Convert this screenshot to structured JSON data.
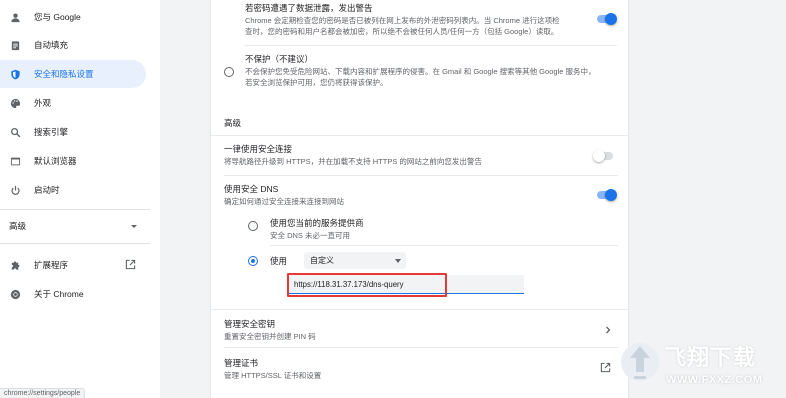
{
  "sidebar": {
    "items": [
      {
        "label": "您与 Google",
        "icon": "person-icon"
      },
      {
        "label": "自动填充",
        "icon": "clipboard-icon"
      },
      {
        "label": "安全和隐私设置",
        "icon": "shield-icon",
        "active": true
      },
      {
        "label": "外观",
        "icon": "palette-icon"
      },
      {
        "label": "搜索引擎",
        "icon": "search-icon"
      },
      {
        "label": "默认浏览器",
        "icon": "browser-icon"
      },
      {
        "label": "启动时",
        "icon": "power-icon"
      }
    ],
    "advanced_label": "高级",
    "extensions_label": "扩展程序",
    "about_label": "关于 Chrome"
  },
  "main": {
    "breach_warning": {
      "title": "若密码遭遇了数据泄露，发出警告",
      "line1": "Chrome 会定期检查您的密码是否已被列在网上发布的外泄密码列表内。当 Chrome 进行这项检",
      "line2": "查时，您的密码和用户名都会被加密，所以绝不会被任何人员/任何一方（包括 Google）读取。",
      "enabled": true
    },
    "no_protection": {
      "title": "不保护（不建议）",
      "line1": "不会保护您免受危险网站、下载内容和扩展程序的侵害。在 Gmail 和 Google 搜索等其他 Google 服务中，",
      "line2": "若安全浏览保护可用，您仍将获得该保护。"
    },
    "advanced_header": "高级",
    "https_only": {
      "title": "一律使用安全连接",
      "subtitle": "将导航路径升级到 HTTPS，并在加载不支持 HTTPS 的网站之前向您发出警告",
      "enabled": false
    },
    "secure_dns": {
      "title": "使用安全 DNS",
      "subtitle": "确定如何通过安全连接来连接到网站",
      "enabled": true,
      "option_current": {
        "title": "使用您当前的服务提供商",
        "subtitle": "安全 DNS 未必一直可用"
      },
      "option_custom": {
        "label": "使用",
        "select_value": "自定义",
        "input_value": "https://118.31.37.173/dns-query"
      }
    },
    "security_keys": {
      "title": "管理安全密钥",
      "subtitle": "重置安全密钥并创建 PIN 码"
    },
    "certificates": {
      "title": "管理证书",
      "subtitle": "管理 HTTPS/SSL 证书和设置"
    }
  },
  "status_bar_url": "chrome://settings/people",
  "watermark": {
    "title": "飞翔下载",
    "url": "WWW.FXXZ.COM"
  },
  "colors": {
    "accent": "#1a73e8",
    "highlight_border": "#e53935",
    "active_nav_bg": "#e8f0fe"
  }
}
